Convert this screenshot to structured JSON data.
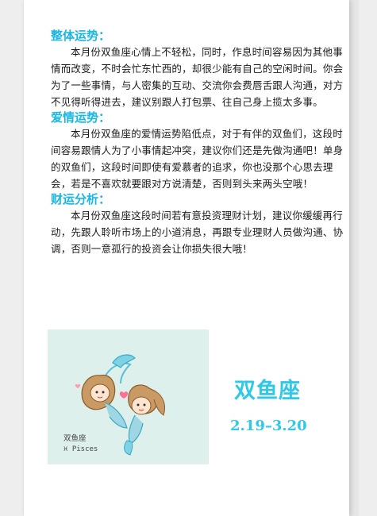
{
  "sections": [
    {
      "heading": "整体运势：",
      "text": "本月份双鱼座心情上不轻松，同时，作息时间容易因为其他事情而改变，不时会忙东忙西的，却很少能有自己的空闲时间。你会为了一些事情，与人密集的互动、交流你会费唇舌跟人沟通，对方不见得听得进去，建议别跟人打包票、往自己身上揽太多事。"
    },
    {
      "heading": "爱情运势：",
      "text": "本月份双鱼座的爱情运势陷低点，对于有伴的双鱼们，这段时间容易跟情人为了小事情起冲突，建议你们还是先做沟通吧！单身的双鱼们，这段时间即使有爱慕者的追求，你也没那个心思去理会，若是不喜欢就要跟对方说清楚，否则到头来两头空哦！"
    },
    {
      "heading": "财运分析：",
      "text": "本月份双鱼座这段时间若有意投资理财计划，建议你缓缓再行动，先跟人聆听市场上的小道消息，再跟专业理财人员做沟通、协调，否则一意孤行的投资会让你损失很大哦！"
    }
  ],
  "illustration": {
    "label_cn": "双鱼座",
    "label_en": "♓ Pisces"
  },
  "sign": {
    "name": "双鱼座",
    "dates": "2.19–3.20"
  },
  "colors": {
    "accent": "#19b6e6",
    "sign_text": "#2ec9e8",
    "illustration_bg": "#ddf0ec"
  }
}
